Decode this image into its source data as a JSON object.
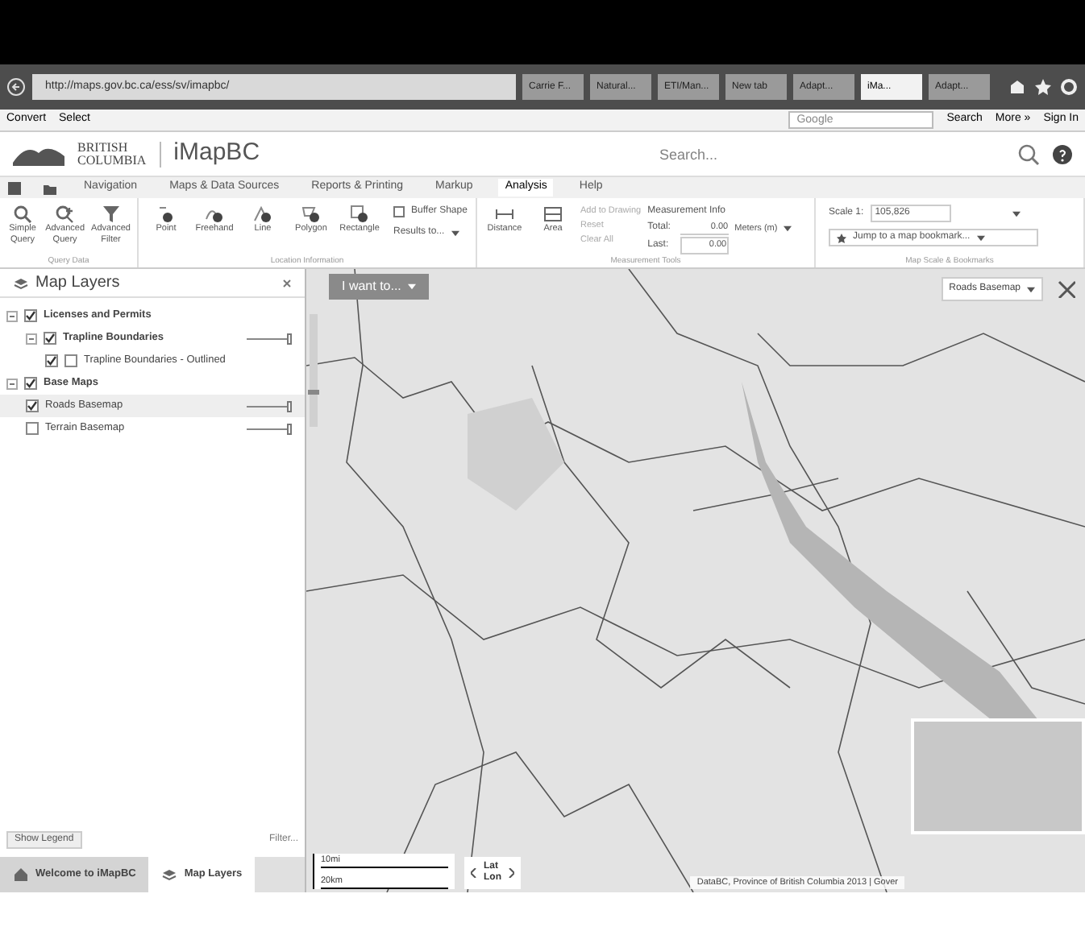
{
  "browser": {
    "url": "http://maps.gov.bc.ca/ess/sv/imapbc/",
    "tabs": [
      {
        "label": "Carrie F...",
        "selected": false
      },
      {
        "label": "Natural...",
        "selected": false
      },
      {
        "label": "ETI/Man...",
        "selected": false
      },
      {
        "label": "New tab",
        "selected": false
      },
      {
        "label": "Adapt...",
        "selected": false
      },
      {
        "label": "iMa...",
        "selected": true
      },
      {
        "label": "Adapt...",
        "selected": false
      }
    ],
    "command_bar": {
      "convert": "Convert",
      "select": "Select",
      "search_value": "Google",
      "search_button": "Search",
      "more": "More »",
      "sign_in": "Sign In"
    }
  },
  "header": {
    "brand_line_1": "BRITISH",
    "brand_line_2": "COLUMBIA",
    "title": "iMapBC",
    "search": {
      "placeholder": "Search..."
    }
  },
  "ribbon_tabs": [
    {
      "label": "Navigation",
      "selected": false
    },
    {
      "label": "Maps & Data Sources",
      "selected": false
    },
    {
      "label": "Reports & Printing",
      "selected": false
    },
    {
      "label": "Markup",
      "selected": false
    },
    {
      "label": "Analysis",
      "selected": true
    },
    {
      "label": "Help",
      "selected": false
    }
  ],
  "ribbon": {
    "query_group": {
      "label": "Query Data",
      "buttons": [
        "Simple Query",
        "Advanced Query",
        "Advanced Filter"
      ]
    },
    "location_group": {
      "label": "Location Information",
      "buttons": [
        "Point",
        "Freehand",
        "Line",
        "Polygon",
        "Rectangle"
      ],
      "buffer_shape": {
        "label": "Buffer Shape",
        "checked": false
      },
      "results_to": "Results to..."
    },
    "measurement_group": {
      "label": "Measurement Tools",
      "buttons": [
        "Distance",
        "Area"
      ],
      "actions": [
        "Add to Drawing",
        "Reset",
        "Clear All"
      ],
      "info_title": "Measurement Info",
      "total_label": "Total:",
      "total_value": "0.00",
      "last_label": "Last:",
      "last_value": "0.00",
      "units": "Meters (m)"
    },
    "scale_group": {
      "label": "Map Scale & Bookmarks",
      "scale_label": "Scale 1:",
      "scale_value": "105,826",
      "bookmark": "Jump to a map bookmark..."
    }
  },
  "layers_panel": {
    "title": "Map Layers",
    "tree": [
      {
        "label": "Licenses and Permits",
        "checked": true,
        "expanded": true,
        "children": [
          {
            "label": "Trapline Boundaries",
            "checked": true,
            "expanded": true,
            "level": 1,
            "children": [
              {
                "label": "Trapline Boundaries - Outlined",
                "checked": true,
                "outline_checked": false
              }
            ]
          }
        ]
      },
      {
        "label": "Base Maps",
        "checked": true,
        "expanded": true,
        "children": [
          {
            "label": "Roads Basemap",
            "checked": true,
            "selected": true,
            "level": 1
          },
          {
            "label": "Terrain Basemap",
            "checked": false,
            "selected": false,
            "level": 1
          }
        ]
      }
    ],
    "show_legend": "Show Legend",
    "filter": "Filter..."
  },
  "bottom_tabs": [
    {
      "label": "Welcome to iMapBC",
      "selected": false
    },
    {
      "label": "Map Layers",
      "selected": true
    }
  ],
  "map": {
    "zoom_slider": {
      "level": 0.3
    },
    "i_want_to": "I want to...",
    "basemap_picker": "Roads Basemap",
    "scale_bar": [
      "10mi",
      "20km"
    ],
    "coordinates_toggle": [
      "Lat",
      "Lon"
    ],
    "attribution": "DataBC, Province of British Columbia 2013 | Gover"
  }
}
